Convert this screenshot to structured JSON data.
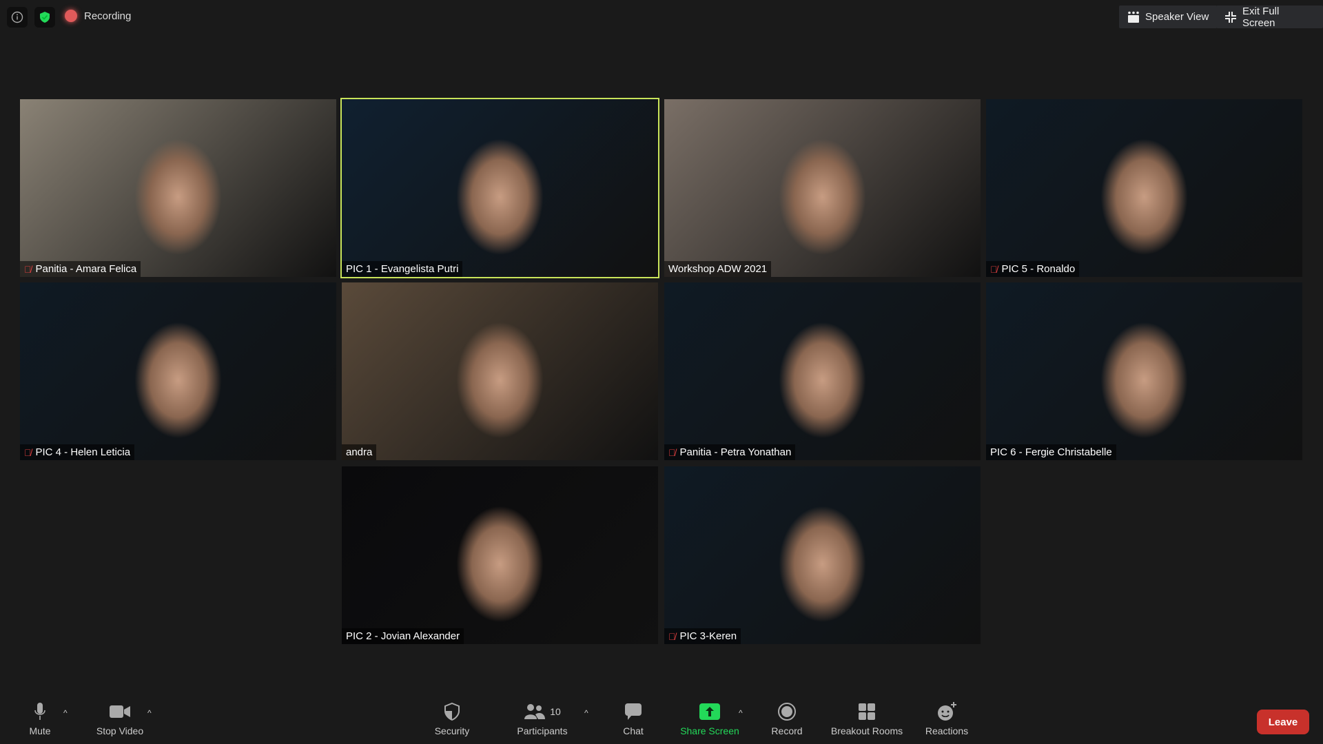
{
  "topbar": {
    "recording_label": "Recording",
    "speaker_view": "Speaker View",
    "exit_full_screen": "Exit Full Screen"
  },
  "participants": [
    {
      "name": "Panitia - Amara Felica",
      "muted": true,
      "bg": "#8a8275"
    },
    {
      "name": "PIC 1 - Evangelista Putri",
      "muted": false,
      "active": true,
      "bg": "#102030"
    },
    {
      "name": "Workshop ADW 2021",
      "muted": false,
      "bg": "#7a6f66"
    },
    {
      "name": "PIC 5 - Ronaldo",
      "muted": true,
      "bg": "#0f1a24"
    },
    {
      "name": "PIC 4 - Helen Leticia",
      "muted": true,
      "bg": "#0f1a24"
    },
    {
      "name": "andra",
      "muted": false,
      "bg": "#5a4a3a"
    },
    {
      "name": "Panitia - Petra Yonathan",
      "muted": true,
      "bg": "#0f1a24"
    },
    {
      "name": "PIC 6 - Fergie Christabelle",
      "muted": false,
      "bg": "#0f1a24"
    },
    {
      "name": "PIC 2 - Jovian Alexander",
      "muted": false,
      "bg": "#0a0a0c"
    },
    {
      "name": "PIC 3-Keren",
      "muted": true,
      "bg": "#0f1a24"
    }
  ],
  "toolbar": {
    "mute": "Mute",
    "stop_video": "Stop Video",
    "security": "Security",
    "participants": "Participants",
    "participants_count": "10",
    "chat": "Chat",
    "share_screen": "Share Screen",
    "record": "Record",
    "breakout_rooms": "Breakout Rooms",
    "reactions": "Reactions",
    "leave": "Leave"
  },
  "colors": {
    "accent_green": "#23d959",
    "leave_red": "#c8312b",
    "active_speaker": "#c9e45a"
  }
}
